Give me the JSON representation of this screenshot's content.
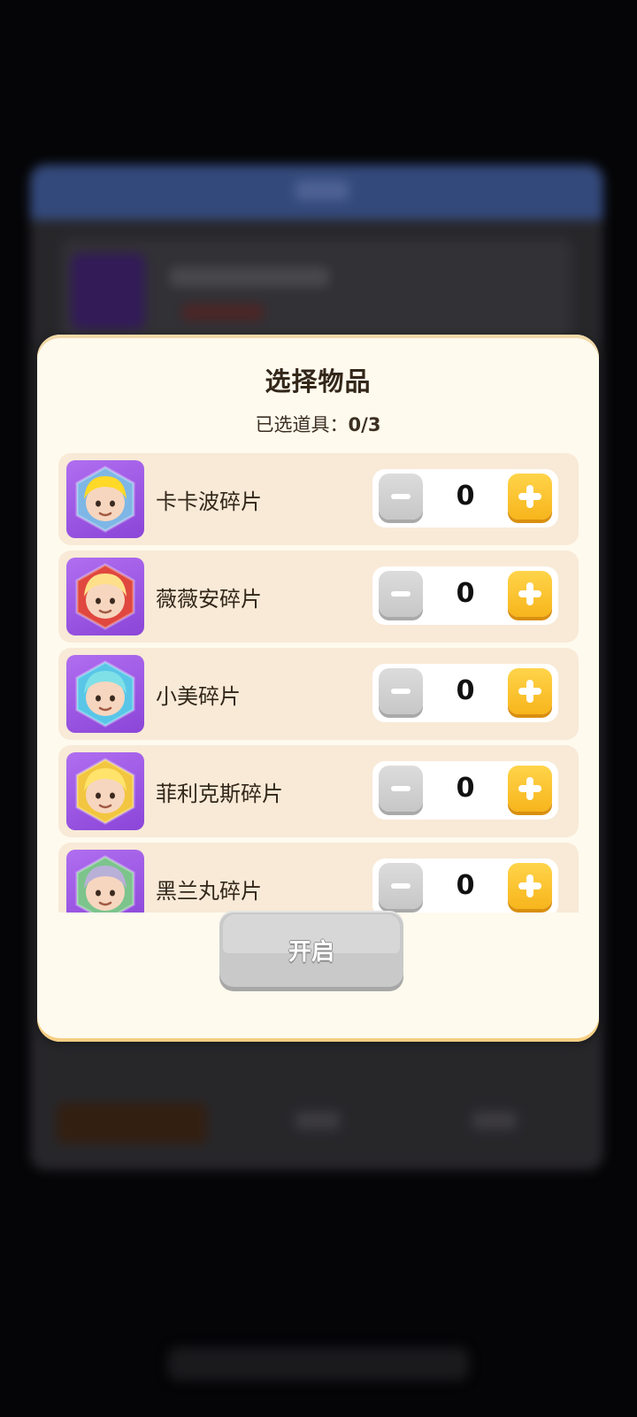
{
  "modal": {
    "title": "选择物品",
    "selected_label": "已选道具：",
    "selected_count": "0/3",
    "open_button": "开启"
  },
  "items": [
    {
      "name": "卡卡波碎片",
      "quantity": "0",
      "hex_color": "#7eb7e6",
      "hair_color": "#ffd928"
    },
    {
      "name": "薇薇安碎片",
      "quantity": "0",
      "hex_color": "#e0473f",
      "hair_color": "#ffe08a"
    },
    {
      "name": "小美碎片",
      "quantity": "0",
      "hex_color": "#59c6e8",
      "hair_color": "#7fe0e8"
    },
    {
      "name": "菲利克斯碎片",
      "quantity": "0",
      "hex_color": "#f2c640",
      "hair_color": "#ffe36b"
    },
    {
      "name": "黑兰丸碎片",
      "quantity": "0",
      "hex_color": "#7cc48c",
      "hair_color": "#b9b0d8"
    }
  ],
  "colors": {
    "modal_bg": "#fffaee",
    "row_bg": "#f8ead7",
    "plus_button": "#f7b51c",
    "minus_button": "#c7c7c7",
    "avatar_bg": "#8b45d8"
  }
}
